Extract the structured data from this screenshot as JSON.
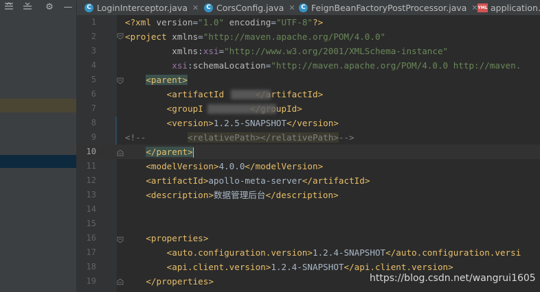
{
  "toolbar": {
    "icons": [
      "collapse-all-icon",
      "expand-all-icon",
      "gear-icon",
      "hide-icon"
    ]
  },
  "tabs": [
    {
      "label": "LoginInterceptor.java",
      "icon": "java-class-icon"
    },
    {
      "label": "CorsConfig.java",
      "icon": "java-class-icon"
    },
    {
      "label": "FeignBeanFactoryPostProcessor.java",
      "icon": "java-class-icon"
    },
    {
      "label": "application.y",
      "icon": "yml-file-icon"
    }
  ],
  "yml_badge": "YML",
  "class_badge": "C",
  "editor": {
    "current_line": 10,
    "lines": [
      {
        "n": "1",
        "parts": [
          [
            "pi",
            "<?xml "
          ],
          [
            "a",
            "version"
          ],
          [
            "plain",
            "="
          ],
          [
            "v",
            "\"1.0\""
          ],
          [
            "a",
            " encoding"
          ],
          [
            "plain",
            "="
          ],
          [
            "v",
            "\"UTF-8\""
          ],
          [
            "pi",
            "?>"
          ]
        ]
      },
      {
        "n": "2",
        "parts": [
          [
            "t",
            "<project "
          ],
          [
            "a",
            "xmlns"
          ],
          [
            "plain",
            "="
          ],
          [
            "v",
            "\"http://maven.apache.org/POM/4.0.0\""
          ]
        ]
      },
      {
        "n": "3",
        "parts": [
          [
            "a",
            "         xmlns"
          ],
          [
            "plain",
            ":"
          ],
          [
            "ns",
            "xsi"
          ],
          [
            "plain",
            "="
          ],
          [
            "v",
            "\"http://www.w3.org/2001/XMLSchema-instance\""
          ]
        ]
      },
      {
        "n": "4",
        "parts": [
          [
            "ns",
            "         xsi"
          ],
          [
            "plain",
            ":"
          ],
          [
            "a",
            "schemaLocation"
          ],
          [
            "plain",
            "="
          ],
          [
            "v",
            "\"http://maven.apache.org/POM/4.0.0 http://maven."
          ]
        ]
      },
      {
        "n": "5",
        "parts": [
          [
            "plain",
            "    "
          ],
          [
            "t",
            "<parent>"
          ]
        ]
      },
      {
        "n": "6",
        "parts": [
          [
            "plain",
            "        "
          ],
          [
            "t",
            "<artifactId"
          ],
          [
            "plain",
            "      "
          ],
          [
            "t",
            "</artifactId>"
          ]
        ]
      },
      {
        "n": "7",
        "parts": [
          [
            "plain",
            "        "
          ],
          [
            "t",
            "<groupI"
          ],
          [
            "plain",
            "         "
          ],
          [
            "t",
            "</groupId>"
          ]
        ]
      },
      {
        "n": "8",
        "parts": [
          [
            "plain",
            "        "
          ],
          [
            "t",
            "<version>"
          ],
          [
            "plain",
            "1.2.5-SNAPSHOT"
          ],
          [
            "t",
            "</version>"
          ]
        ]
      },
      {
        "n": "9",
        "parts": [
          [
            "c",
            "<!--        "
          ],
          [
            "c",
            "<relativePath></relativePath>"
          ],
          [
            "c",
            "-->"
          ]
        ]
      },
      {
        "n": "10",
        "parts": [
          [
            "plain",
            "    "
          ],
          [
            "t",
            "</parent>"
          ]
        ]
      },
      {
        "n": "11",
        "parts": [
          [
            "plain",
            "    "
          ],
          [
            "t",
            "<modelVersion>"
          ],
          [
            "plain",
            "4.0.0"
          ],
          [
            "t",
            "</modelVersion>"
          ]
        ]
      },
      {
        "n": "12",
        "parts": [
          [
            "plain",
            "    "
          ],
          [
            "t",
            "<artifactId>"
          ],
          [
            "plain",
            "apollo-meta-server"
          ],
          [
            "t",
            "</artifactId>"
          ]
        ]
      },
      {
        "n": "13",
        "parts": [
          [
            "plain",
            "    "
          ],
          [
            "t",
            "<description>"
          ],
          [
            "plain",
            "数据管理后台"
          ],
          [
            "t",
            "</description>"
          ]
        ]
      },
      {
        "n": "14",
        "parts": []
      },
      {
        "n": "15",
        "parts": []
      },
      {
        "n": "16",
        "parts": [
          [
            "plain",
            "    "
          ],
          [
            "t",
            "<properties>"
          ]
        ]
      },
      {
        "n": "17",
        "parts": [
          [
            "plain",
            "        "
          ],
          [
            "t",
            "<auto.configuration.version>"
          ],
          [
            "plain",
            "1.2.4-SNAPSHOT"
          ],
          [
            "t",
            "</auto.configuration.versi"
          ]
        ]
      },
      {
        "n": "18",
        "parts": [
          [
            "plain",
            "        "
          ],
          [
            "t",
            "<api.client.version>"
          ],
          [
            "plain",
            "1.2.4-SNAPSHOT"
          ],
          [
            "t",
            "</api.client.version>"
          ]
        ]
      },
      {
        "n": "19",
        "parts": [
          [
            "plain",
            "    "
          ],
          [
            "t",
            "</properties>"
          ]
        ]
      }
    ]
  },
  "watermark": "https://blog.csdn.net/wangrui1605"
}
